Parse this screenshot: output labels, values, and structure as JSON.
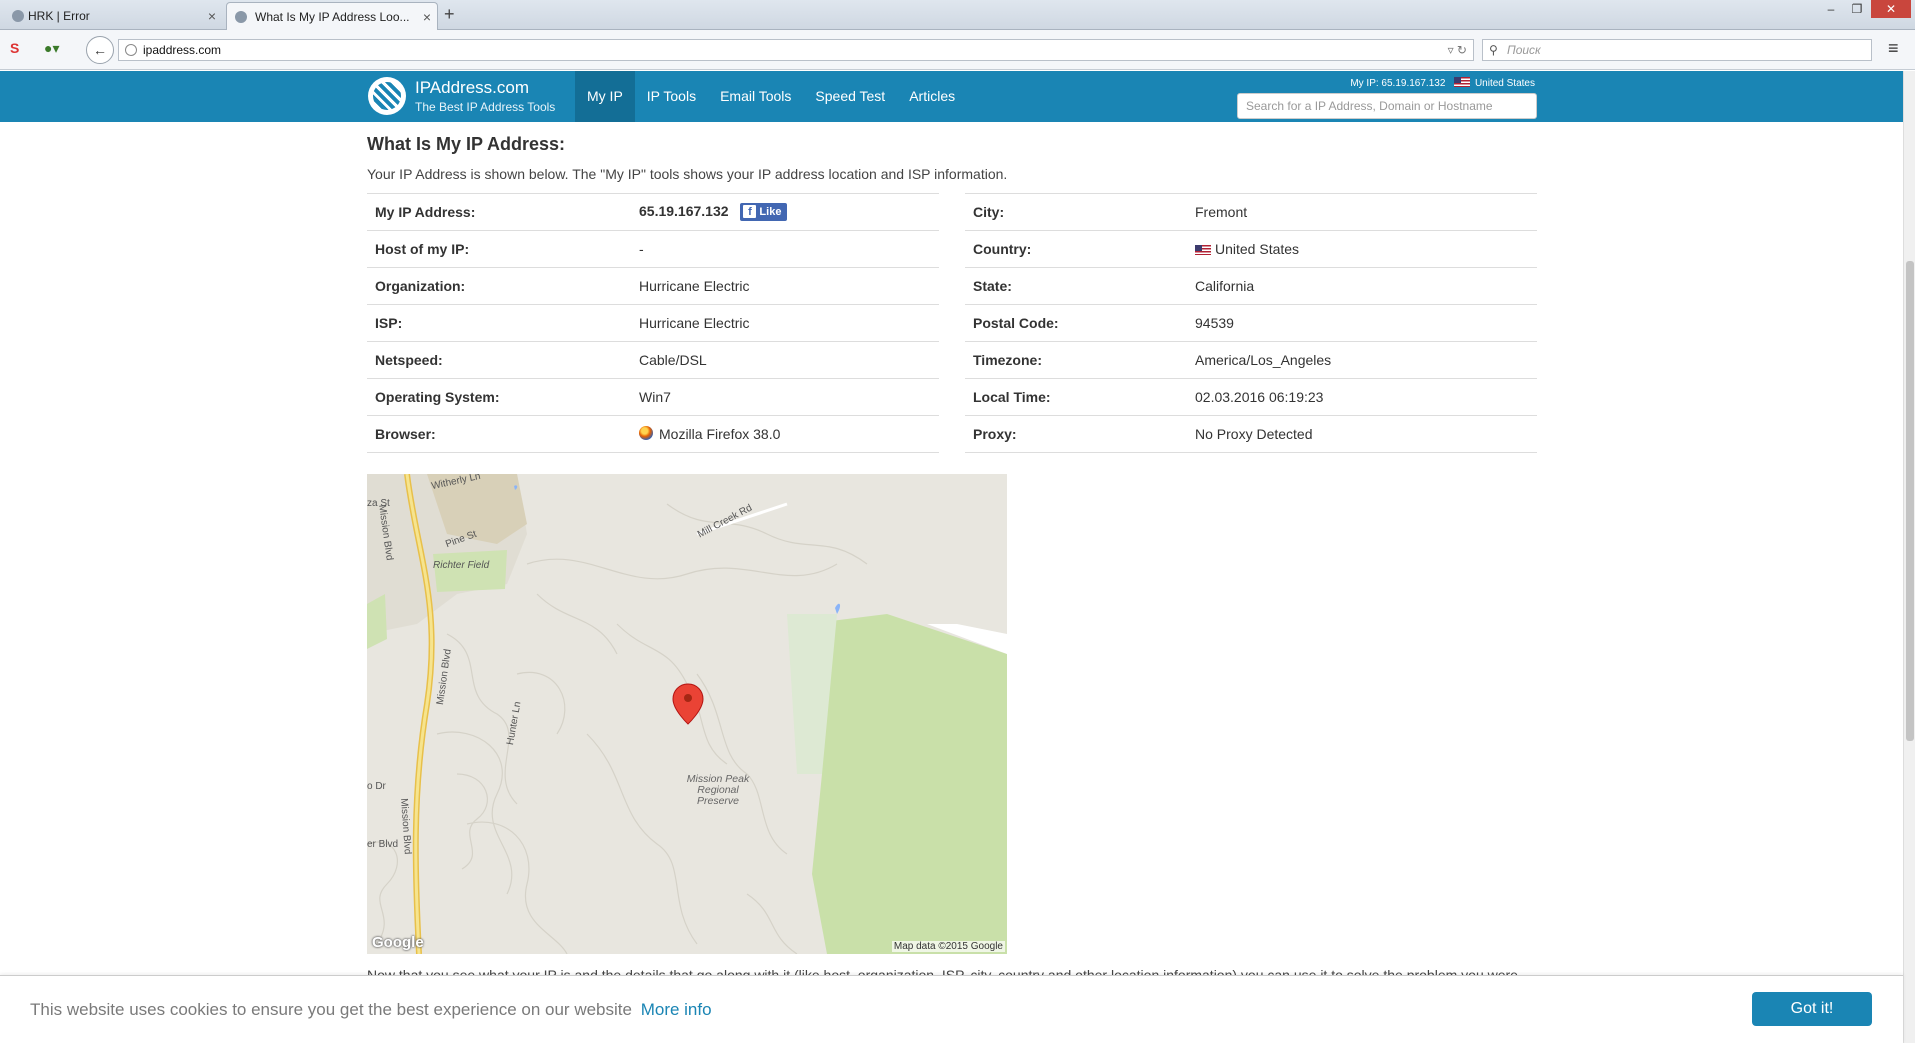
{
  "browser": {
    "tabs": [
      {
        "title": "HRK | Error",
        "active": false
      },
      {
        "title": "What Is My IP Address Loo...",
        "active": true
      }
    ],
    "new_tab": "+",
    "url": "ipaddress.com",
    "search_placeholder": "Поиск"
  },
  "site": {
    "logo_title": "IPAddress.com",
    "logo_tagline": "The Best IP Address Tools",
    "nav": [
      "My IP",
      "IP Tools",
      "Email Tools",
      "Speed Test",
      "Articles"
    ],
    "my_ip_label": "My IP: 65.19.167.132",
    "my_ip_country": "United States",
    "search_placeholder": "Search for a IP Address, Domain or Hostname"
  },
  "content": {
    "title": "What Is My IP Address:",
    "intro": "Your IP Address is shown below. The \"My IP\" tools shows your IP address location and ISP information.",
    "left": [
      {
        "label": "My IP Address:",
        "value": "65.19.167.132"
      },
      {
        "label": "Host of my IP:",
        "value": "-"
      },
      {
        "label": "Organization:",
        "value": "Hurricane Electric"
      },
      {
        "label": "ISP:",
        "value": "Hurricane Electric"
      },
      {
        "label": "Netspeed:",
        "value": "Cable/DSL"
      },
      {
        "label": "Operating System:",
        "value": "Win7"
      },
      {
        "label": "Browser:",
        "value": "Mozilla Firefox 38.0"
      }
    ],
    "right": [
      {
        "label": "City:",
        "value": "Fremont"
      },
      {
        "label": "Country:",
        "value": "United States"
      },
      {
        "label": "State:",
        "value": "California"
      },
      {
        "label": "Postal Code:",
        "value": "94539"
      },
      {
        "label": "Timezone:",
        "value": "America/Los_Angeles"
      },
      {
        "label": "Local Time:",
        "value": "02.03.2016 06:19:23"
      },
      {
        "label": "Proxy:",
        "value": "No Proxy Detected"
      }
    ],
    "fb_like": "Like",
    "cutoff_text": "Now that you see what your IP is and the details that go along with it (like host, organization, ISP, city, country and other location information) you can use it to solve the problem you were"
  },
  "map": {
    "labels": {
      "witherly": "Witherly Ln",
      "za_st": "za St",
      "mission_blvd": "Mission Blvd",
      "pine_st": "Pine St",
      "richter": "Richter Field",
      "mill_creek": "Mill Creek Rd",
      "hunter": "Hunter Ln",
      "o_dr": "o Dr",
      "er_blvd": "er Blvd",
      "mission_peak": "Mission Peak Regional Preserve"
    },
    "credit": "Map data ©2015 Google",
    "logo": "Google"
  },
  "cookie": {
    "text": "This website uses cookies to ensure you get the best experience on our website",
    "link": "More info",
    "button": "Got it!"
  }
}
